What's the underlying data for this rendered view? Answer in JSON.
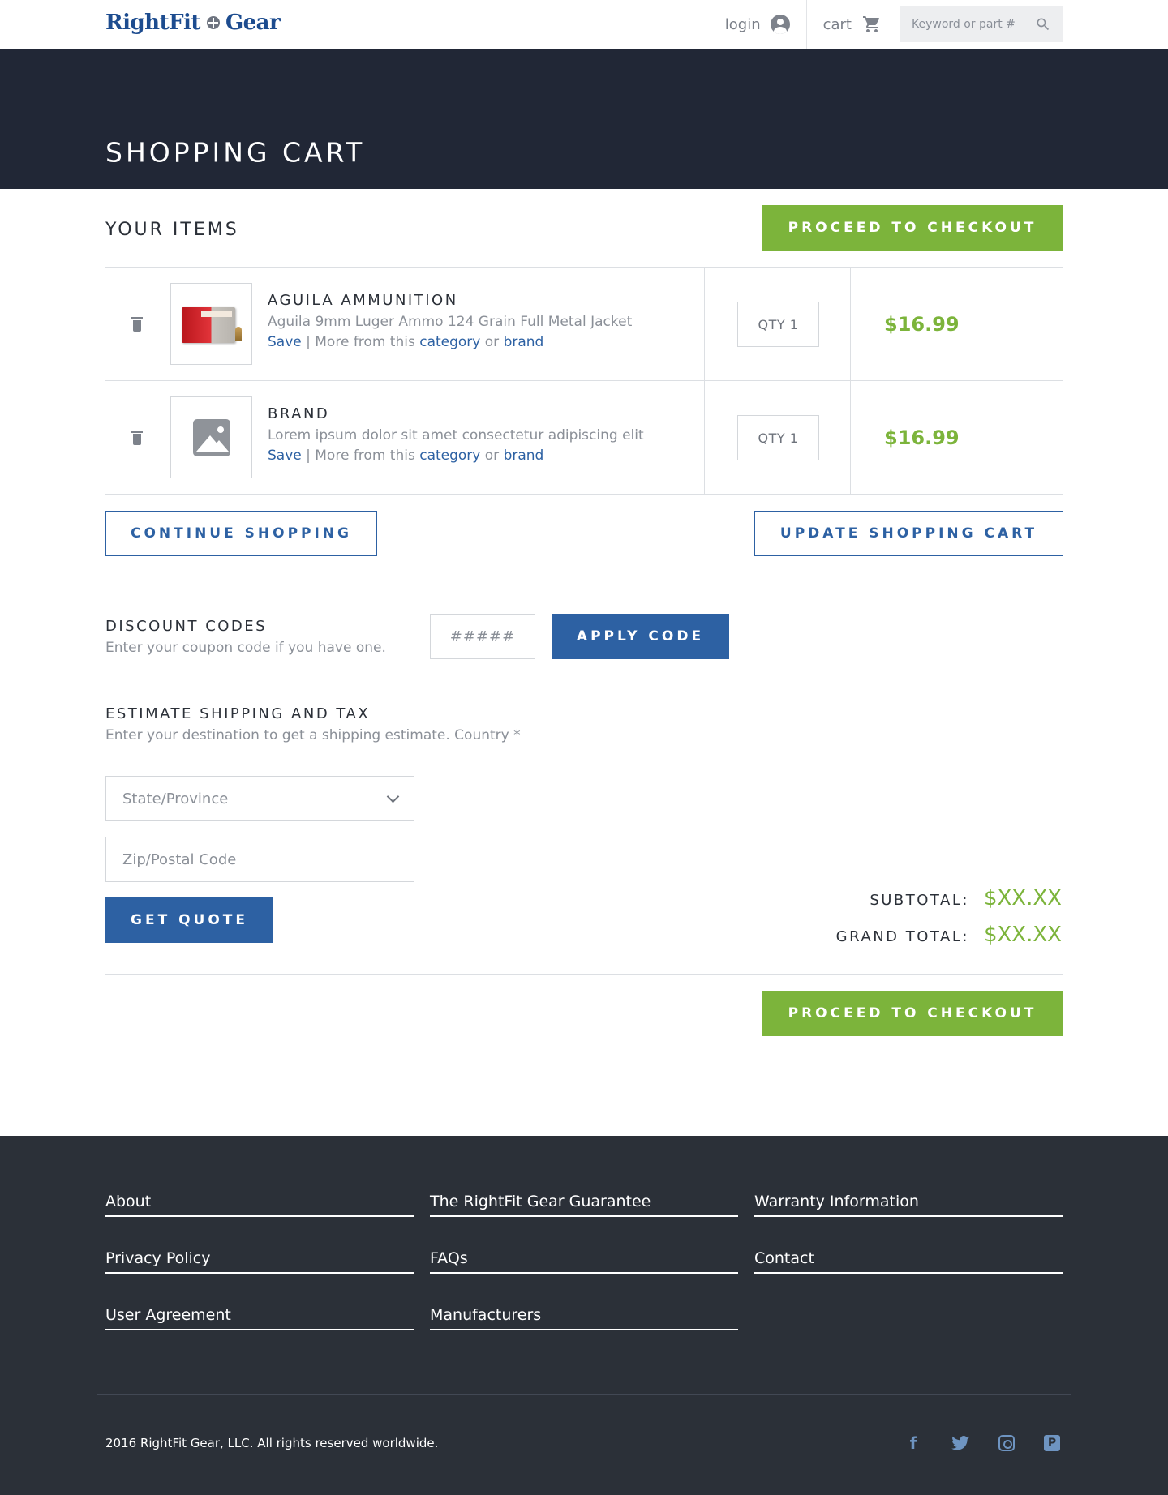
{
  "header": {
    "logo_left": "RightFit",
    "logo_right": "Gear",
    "login_label": "login",
    "cart_label": "cart",
    "search_placeholder": "Keyword or part #"
  },
  "banner": {
    "title": "SHOPPING CART"
  },
  "items_section": {
    "title": "YOUR ITEMS",
    "checkout_label": "PROCEED TO CHECKOUT"
  },
  "cart_items": [
    {
      "title": "AGUILA AMMUNITION",
      "description": "Aguila 9mm Luger Ammo 124 Grain Full Metal Jacket",
      "save": "Save",
      "separator": " | More from this ",
      "category": "category",
      "or": " or ",
      "brand": "brand",
      "qty": "QTY 1",
      "price": "$16.99"
    },
    {
      "title": "BRAND",
      "description": "Lorem ipsum dolor sit amet consectetur adipiscing elit",
      "save": "Save",
      "separator": " | More from this ",
      "category": "category",
      "or": " or ",
      "brand": "brand",
      "qty": "QTY 1",
      "price": "$16.99"
    }
  ],
  "actions": {
    "continue_label": "CONTINUE SHOPPING",
    "update_label": "UPDATE SHOPPING CART"
  },
  "discount": {
    "title": "DISCOUNT CODES",
    "subtitle": "Enter your coupon code if you have one.",
    "placeholder": "#####",
    "apply_label": "APPLY CODE"
  },
  "shipping": {
    "title": "ESTIMATE SHIPPING AND TAX",
    "subtitle": "Enter your destination to get a shipping estimate. Country *",
    "state_value": "State/Province",
    "zip_placeholder": "Zip/Postal Code",
    "quote_label": "GET QUOTE"
  },
  "totals": {
    "subtotal_label": "SUBTOTAL:",
    "subtotal_value": "$XX.XX",
    "grand_label": "GRAND TOTAL:",
    "grand_value": "$XX.XX"
  },
  "bottom": {
    "checkout_label": "PROCEED TO CHECKOUT"
  },
  "footer": {
    "links": [
      "About",
      "The RightFit Gear Guarantee",
      "Warranty Information",
      "Privacy Policy",
      "FAQs",
      "Contact",
      "User Agreement",
      "Manufacturers"
    ],
    "copyright": "2016 RightFit Gear, LLC. All rights reserved worldwide."
  },
  "colors": {
    "navy": "#212736",
    "green": "#7cb43b",
    "blue": "#2d61a3",
    "footer": "#2b3038"
  },
  "icons": [
    "user-icon",
    "cart-icon",
    "search-icon",
    "trash-icon",
    "image-placeholder-icon",
    "chevron-down-icon",
    "facebook-icon",
    "twitter-icon",
    "instagram-icon",
    "pinterest-icon"
  ]
}
